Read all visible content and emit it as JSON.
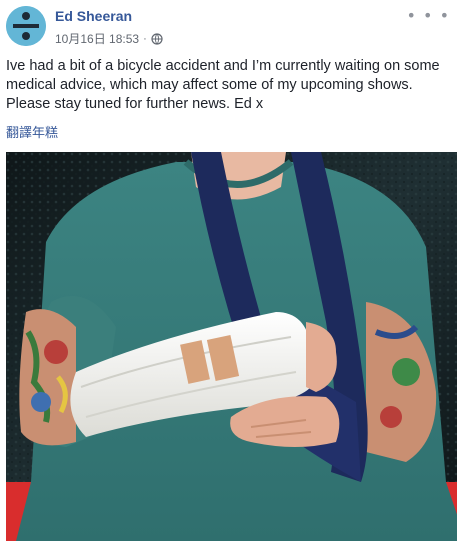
{
  "post": {
    "author": "Ed Sheeran",
    "timestamp": "10月16日 18:53",
    "separator": "·",
    "privacy_icon": "globe-icon",
    "more_icon": "more-options-icon",
    "more_glyph": "• • •",
    "text_lines": [
      "Ive had a bit of a bicycle accident and I’m currently waiting on some",
      "medical advice, which may affect some of my upcoming shows.",
      "Please stay tuned for further news. Ed x"
    ],
    "translate_label": "翻譯年糕"
  },
  "colors": {
    "link": "#365899",
    "meta": "#616770",
    "shirt": "#3f8a86",
    "sling": "#1d2a5c",
    "cast": "#f1f1ee",
    "tape": "#d8a37c",
    "wall_red": "#d92d2d"
  }
}
